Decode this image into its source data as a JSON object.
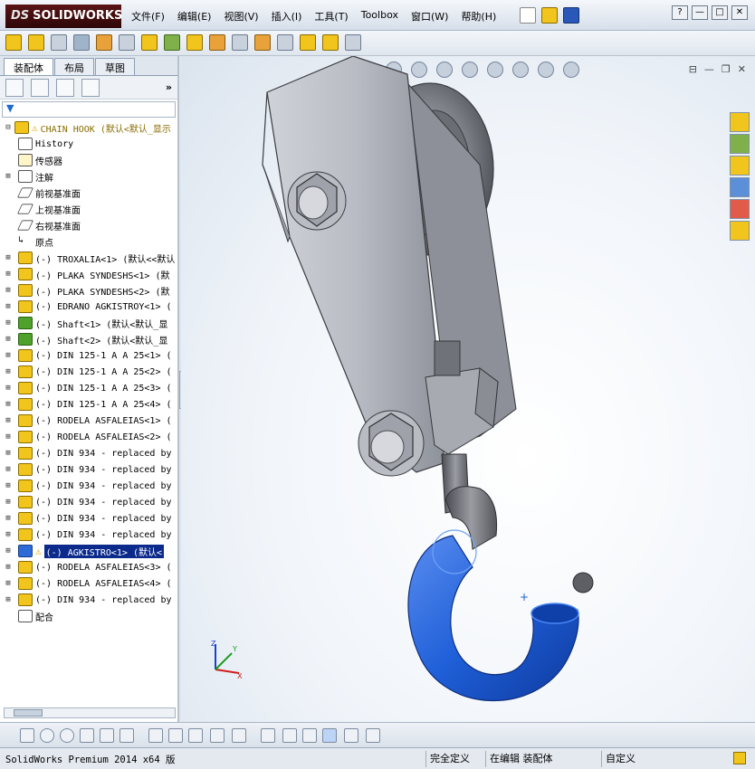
{
  "app": {
    "logo": "SOLIDWORKS",
    "logo_prefix": "DS"
  },
  "menu": [
    "文件(F)",
    "编辑(E)",
    "视图(V)",
    "插入(I)",
    "工具(T)",
    "Toolbox",
    "窗口(W)",
    "帮助(H)"
  ],
  "window_controls": {
    "help": "?",
    "minimize": "—",
    "restore": "□",
    "close": "✕"
  },
  "tabs": [
    "装配体",
    "布局",
    "草图"
  ],
  "filter_icon": "filter-icon",
  "tree": {
    "root": "CHAIN HOOK  (默认<默认_显示",
    "items": [
      {
        "label": "History",
        "icon": "history-icon",
        "cls": "hist",
        "exp": false
      },
      {
        "label": "传感器",
        "icon": "sensor-icon",
        "cls": "sensor",
        "exp": false
      },
      {
        "label": "注解",
        "icon": "annotation-icon",
        "cls": "annot",
        "exp": true
      },
      {
        "label": "前视基准面",
        "icon": "plane-icon",
        "cls": "plane",
        "exp": false
      },
      {
        "label": "上视基准面",
        "icon": "plane-icon",
        "cls": "plane",
        "exp": false
      },
      {
        "label": "右视基准面",
        "icon": "plane-icon",
        "cls": "plane",
        "exp": false
      },
      {
        "label": "原点",
        "icon": "origin-icon",
        "cls": "origin",
        "exp": false
      },
      {
        "label": "(-) TROXALIA<1> (默认<<默认",
        "icon": "part-icon",
        "cls": "yellow",
        "exp": true
      },
      {
        "label": "(-) PLAKA SYNDESHS<1> (默",
        "icon": "part-icon",
        "cls": "yellow",
        "exp": true
      },
      {
        "label": "(-) PLAKA SYNDESHS<2> (默",
        "icon": "part-icon",
        "cls": "yellow",
        "exp": true
      },
      {
        "label": "(-) EDRANO AGKISTROY<1> (",
        "icon": "part-icon",
        "cls": "yellow",
        "exp": true
      },
      {
        "label": "(-) Shaft<1> (默认<默认_显",
        "icon": "part-icon",
        "cls": "green",
        "exp": true
      },
      {
        "label": "(-) Shaft<2> (默认<默认_显",
        "icon": "part-icon",
        "cls": "green",
        "exp": true
      },
      {
        "label": "(-) DIN 125-1 A A 25<1> (",
        "icon": "part-icon",
        "cls": "yellow",
        "exp": true
      },
      {
        "label": "(-) DIN 125-1 A A 25<2> (",
        "icon": "part-icon",
        "cls": "yellow",
        "exp": true
      },
      {
        "label": "(-) DIN 125-1 A A 25<3> (",
        "icon": "part-icon",
        "cls": "yellow",
        "exp": true
      },
      {
        "label": "(-) DIN 125-1 A A 25<4> (",
        "icon": "part-icon",
        "cls": "yellow",
        "exp": true
      },
      {
        "label": "(-) RODELA ASFALEIAS<1> (",
        "icon": "part-icon",
        "cls": "yellow",
        "exp": true
      },
      {
        "label": "(-) RODELA ASFALEIAS<2> (",
        "icon": "part-icon",
        "cls": "yellow",
        "exp": true
      },
      {
        "label": "(-) DIN 934 - replaced by",
        "icon": "part-icon",
        "cls": "yellow",
        "exp": true
      },
      {
        "label": "(-) DIN 934 - replaced by",
        "icon": "part-icon",
        "cls": "yellow",
        "exp": true
      },
      {
        "label": "(-) DIN 934 - replaced by",
        "icon": "part-icon",
        "cls": "yellow",
        "exp": true
      },
      {
        "label": "(-) DIN 934 - replaced by",
        "icon": "part-icon",
        "cls": "yellow",
        "exp": true
      },
      {
        "label": "(-) DIN 934 - replaced by",
        "icon": "part-icon",
        "cls": "yellow",
        "exp": true
      },
      {
        "label": "(-) DIN 934 - replaced by",
        "icon": "part-icon",
        "cls": "yellow",
        "exp": true
      },
      {
        "label": "(-) AGKISTRO<1> (默认<",
        "icon": "part-icon",
        "cls": "blue",
        "exp": true,
        "warn": true,
        "selected": true
      },
      {
        "label": "(-) RODELA ASFALEIAS<3> (",
        "icon": "part-icon",
        "cls": "yellow",
        "exp": true
      },
      {
        "label": "(-) RODELA ASFALEIAS<4> (",
        "icon": "part-icon",
        "cls": "yellow",
        "exp": true
      },
      {
        "label": "(-) DIN 934 - replaced by",
        "icon": "part-icon",
        "cls": "yellow",
        "exp": true
      },
      {
        "label": "配合",
        "icon": "mates-icon",
        "cls": "mates",
        "exp": false
      }
    ]
  },
  "status": {
    "left": "SolidWorks Premium 2014 x64 版",
    "state": "完全定义",
    "mode": "在编辑 装配体",
    "custom": "自定义"
  },
  "colors": {
    "hook_blue": "#1f5fd8",
    "selected_bg": "#0b2a8c"
  }
}
